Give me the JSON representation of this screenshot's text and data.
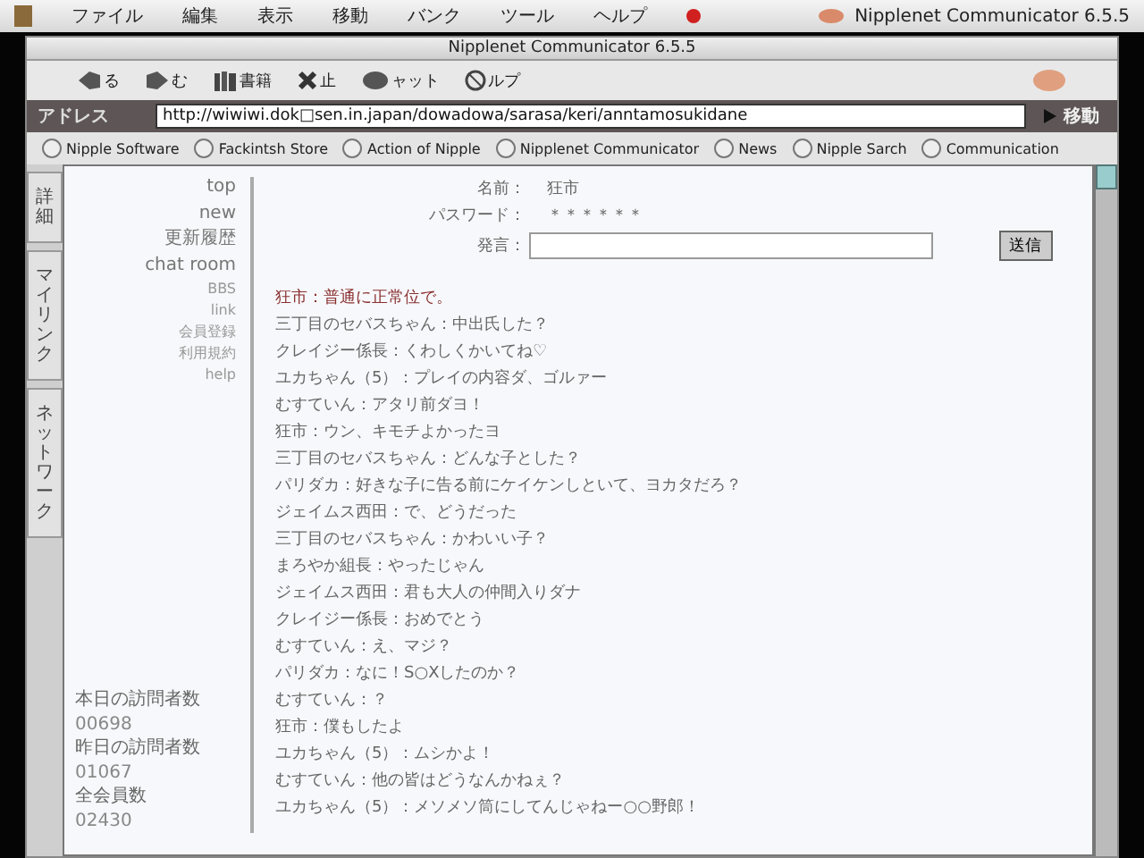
{
  "menu_bar": {
    "items": [
      "ファイル",
      "編集",
      "表示",
      "移動",
      "バンク",
      "ツール",
      "ヘルプ"
    ],
    "app_title": "Nipplenet Communicator 6.5.5"
  },
  "window": {
    "title": "Nipplenet Communicator 6.5.5"
  },
  "toolbar": {
    "buttons": [
      {
        "kind": "back",
        "label": "る"
      },
      {
        "kind": "forward",
        "label": "む"
      },
      {
        "kind": "books",
        "label": "書籍"
      },
      {
        "kind": "stop",
        "label": "止"
      },
      {
        "kind": "chat",
        "label": "ャット"
      },
      {
        "kind": "help",
        "label": "ルプ"
      }
    ]
  },
  "address_bar": {
    "label": "アドレス",
    "url": "http://wiwiwi.dok□sen.in.japan/dowadowa/sarasa/keri/anntamosukidane",
    "go": "移動"
  },
  "bookmarks": [
    "Nipple Software",
    "Fackintsh Store",
    "Action of Nipple",
    "Nipplenet Communicator",
    "News",
    "Nipple Sarch",
    "Communication"
  ],
  "side_tabs": [
    "詳細",
    "マイリンク",
    "ネットワーク"
  ],
  "nav": [
    {
      "label": "top",
      "kind": "main"
    },
    {
      "label": "new",
      "kind": "main"
    },
    {
      "label": "更新履歴",
      "kind": "main"
    },
    {
      "label": "chat room",
      "kind": "main"
    },
    {
      "label": "BBS",
      "kind": "sub"
    },
    {
      "label": "link",
      "kind": "sub"
    },
    {
      "label": "会員登録",
      "kind": "sub"
    },
    {
      "label": "利用規約",
      "kind": "sub"
    },
    {
      "label": "help",
      "kind": "sub"
    }
  ],
  "stats": [
    {
      "label": "本日の訪問者数",
      "value": "00698"
    },
    {
      "label": "昨日の訪問者数",
      "value": "01067"
    },
    {
      "label": "全会員数",
      "value": "02430"
    }
  ],
  "form": {
    "name_label": "名前：",
    "name": "狂市",
    "password_label": "パスワード：",
    "password": "＊＊＊＊＊＊",
    "message_label": "発言：",
    "submit": "送信"
  },
  "chat": [
    {
      "kind": "own",
      "text": "狂市：普通に正常位で。"
    },
    {
      "kind": "other",
      "text": "三丁目のセバスちゃん：中出氏した？"
    },
    {
      "kind": "other",
      "text": "クレイジー係長：くわしくかいてね♡"
    },
    {
      "kind": "other",
      "text": "ユカちゃん（5）：プレイの内容ダ、ゴルァー"
    },
    {
      "kind": "other",
      "text": "むすていん：アタリ前ダヨ！"
    },
    {
      "kind": "other",
      "text": "狂市：ウン、キモチよかったヨ"
    },
    {
      "kind": "other",
      "text": "三丁目のセバスちゃん：どんな子とした？"
    },
    {
      "kind": "other",
      "text": "パリダカ：好きな子に告る前にケイケンしといて、ヨカタだろ？"
    },
    {
      "kind": "other",
      "text": "ジェイムス西田：で、どうだった"
    },
    {
      "kind": "other",
      "text": "三丁目のセバスちゃん：かわいい子？"
    },
    {
      "kind": "other",
      "text": "まろやか組長：やったじゃん"
    },
    {
      "kind": "other",
      "text": "ジェイムス西田：君も大人の仲間入りダナ"
    },
    {
      "kind": "other",
      "text": "クレイジー係長：おめでとう"
    },
    {
      "kind": "other",
      "text": "むすていん：え、マジ？"
    },
    {
      "kind": "other",
      "text": "パリダカ：なに！S○Xしたのか？"
    },
    {
      "kind": "other",
      "text": "むすていん：？"
    },
    {
      "kind": "other",
      "text": "狂市：僕もしたよ"
    },
    {
      "kind": "other",
      "text": "ユカちゃん（5）：ムシかよ！"
    },
    {
      "kind": "other",
      "text": "むすていん：他の皆はどうなんかねぇ？"
    },
    {
      "kind": "other",
      "text": "ユカちゃん（5）：メソメソ筒にしてんじゃねー○○野郎！"
    }
  ]
}
